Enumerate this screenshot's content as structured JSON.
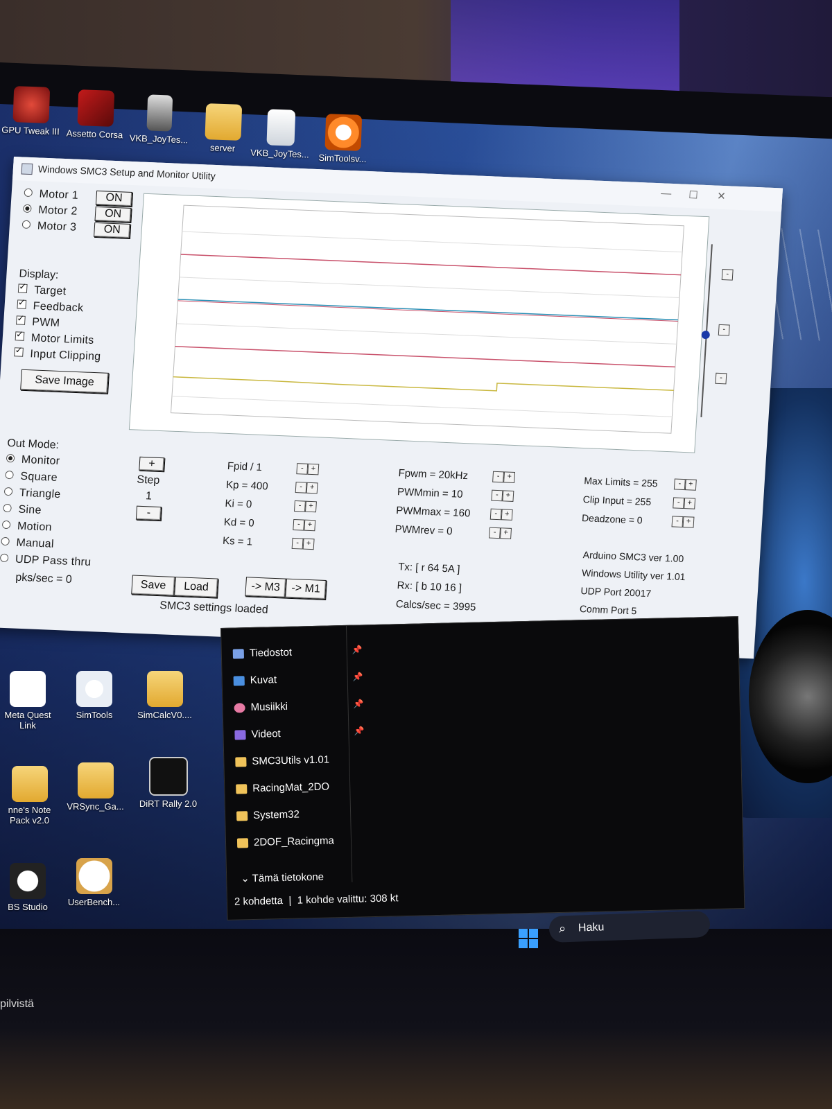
{
  "desktop": {
    "icons_top": [
      {
        "label": "GPU Tweak III",
        "icon": "gpu-tweak-icon"
      },
      {
        "label": "Assetto Corsa",
        "icon": "assetto-corsa-icon"
      },
      {
        "label": "VKB_JoyTes...",
        "icon": "joystick-icon"
      },
      {
        "label": "server",
        "icon": "folder-icon"
      },
      {
        "label": "VKB_JoyTes...",
        "icon": "file-icon"
      },
      {
        "label": "SimToolsv...",
        "icon": "simtools-power-icon"
      }
    ],
    "icons_left": [
      {
        "label": "Meta Quest Link",
        "icon": "meta-icon"
      },
      {
        "label": "SimTools",
        "icon": "gear-icon"
      },
      {
        "label": "SimCalcV0....",
        "icon": "folder-icon"
      },
      {
        "label": "nne's Note Pack v2.0",
        "icon": "folder-icon"
      },
      {
        "label": "VRSync_Ga...",
        "icon": "folder-icon"
      },
      {
        "label": "DiRT Rally 2.0",
        "icon": "dirt-rally-icon"
      },
      {
        "label": "BS Studio",
        "icon": "obs-icon"
      },
      {
        "label": "UserBench...",
        "icon": "gauge-icon"
      }
    ]
  },
  "smc3": {
    "title": "Windows SMC3 Setup and Monitor Utility",
    "motors": [
      {
        "label": "Motor 1",
        "selected": false,
        "button": "ON"
      },
      {
        "label": "Motor 2",
        "selected": true,
        "button": "ON"
      },
      {
        "label": "Motor 3",
        "selected": false,
        "button": "ON"
      }
    ],
    "display": {
      "heading": "Display:",
      "options": [
        {
          "label": "Target",
          "checked": true
        },
        {
          "label": "Feedback",
          "checked": true
        },
        {
          "label": "PWM",
          "checked": true
        },
        {
          "label": "Motor Limits",
          "checked": true
        },
        {
          "label": "Input Clipping",
          "checked": true
        }
      ]
    },
    "save_image": "Save Image",
    "out_mode": {
      "heading": "Out Mode:",
      "options": [
        {
          "label": "Monitor",
          "selected": true
        },
        {
          "label": "Square",
          "selected": false
        },
        {
          "label": "Triangle",
          "selected": false
        },
        {
          "label": "Sine",
          "selected": false
        },
        {
          "label": "Motion",
          "selected": false
        },
        {
          "label": "Manual",
          "selected": false
        },
        {
          "label": "UDP Pass thru",
          "selected": false
        }
      ],
      "pks": "pks/sec = 0"
    },
    "step": {
      "plus": "+",
      "label": "Step",
      "value": "1",
      "minus": "-"
    },
    "pid": [
      "Fpid / 1",
      "Kp = 400",
      "Ki = 0",
      "Kd = 0",
      "Ks = 1"
    ],
    "pwm": [
      "Fpwm = 20kHz",
      "PWMmin = 10",
      "PWMmax = 160",
      "PWMrev = 0"
    ],
    "limits": [
      "Max Limits = 255",
      "Clip Input = 255",
      "Deadzone = 0"
    ],
    "info": [
      "Arduino SMC3 ver 1.00",
      "Windows Utility ver 1.01",
      "UDP Port 20017",
      "Comm Port 5"
    ],
    "tx": "Tx: [ r 64 5A ]",
    "rx": "Rx: [ b 10 16 ]",
    "calcs": "Calcs/sec = 3995",
    "buttons": {
      "save": "Save",
      "load": "Load",
      "m3": "-> M3",
      "m1": "-> M1"
    },
    "status": "SMC3 settings loaded",
    "pm_minus": "-",
    "pm_plus": "+",
    "plot_colors": {
      "target": "#c8506a",
      "feedback": "#2a8fb5",
      "pwm": "#c9b840",
      "limits": "#c8506a"
    }
  },
  "explorer": {
    "nav": [
      {
        "label": "Tiedostot",
        "icon": "documents-icon",
        "pinned": true
      },
      {
        "label": "Kuvat",
        "icon": "pictures-icon",
        "pinned": true
      },
      {
        "label": "Musiikki",
        "icon": "music-icon",
        "pinned": true
      },
      {
        "label": "Videot",
        "icon": "videos-icon",
        "pinned": true
      },
      {
        "label": "SMC3Utils v1.01",
        "icon": "folder-icon",
        "pinned": false
      },
      {
        "label": "RacingMat_2DO",
        "icon": "folder-icon",
        "pinned": false
      },
      {
        "label": "System32",
        "icon": "folder-icon",
        "pinned": false
      },
      {
        "label": "2DOF_Racingma",
        "icon": "folder-icon",
        "pinned": false
      }
    ],
    "this_pc": "Tämä tietokone",
    "status_items": "2 kohdetta",
    "status_selected": "1 kohde valittu: 308 kt"
  },
  "taskbar": {
    "search": "Haku"
  },
  "bottom_text": "pilvistä"
}
